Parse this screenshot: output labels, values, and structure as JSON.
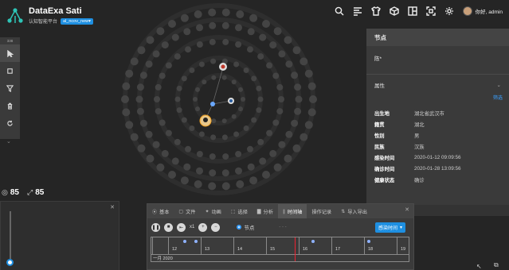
{
  "app": {
    "title": "DataExa Sati",
    "subtitle": "认知智能平台",
    "dataset_tag": "al_ncov_new▾"
  },
  "toolbar": {
    "icons": [
      "search-icon",
      "list-icon",
      "shirt-icon",
      "cube-icon",
      "layout-icon",
      "scan-icon",
      "gear-icon"
    ],
    "user_greeting": "你好, admin"
  },
  "left_tools": {
    "zoom_level": "338",
    "tools": [
      "pointer-icon",
      "rect-select-icon",
      "filter-icon",
      "delete-icon",
      "refresh-icon"
    ]
  },
  "counts": {
    "nodes": "85",
    "edges": "85"
  },
  "right_panel": {
    "header": "节点",
    "name": "陈*",
    "section_label": "属性",
    "filter_label": "筛选",
    "properties": [
      {
        "key": "出生地",
        "value": "湖北省武汉市"
      },
      {
        "key": "籍贯",
        "value": "湖北"
      },
      {
        "key": "性别",
        "value": "男"
      },
      {
        "key": "民族",
        "value": "汉族"
      },
      {
        "key": "感染时间",
        "value": "2020-01-12 09:09:56"
      },
      {
        "key": "确诊时间",
        "value": "2020-01-28 13:09:56"
      },
      {
        "key": "健康状态",
        "value": "确诊"
      }
    ]
  },
  "bottom_panel": {
    "tabs": [
      {
        "label": "基本",
        "icon": "circle-icon"
      },
      {
        "label": "文件",
        "icon": "folder-icon"
      },
      {
        "label": "动画",
        "icon": "wand-icon"
      },
      {
        "label": "选择",
        "icon": "select-icon"
      },
      {
        "label": "分析",
        "icon": "chart-icon"
      },
      {
        "label": "时间轴",
        "icon": "timeline-icon",
        "active": true
      },
      {
        "label": "操作记录",
        "icon": ""
      },
      {
        "label": "导入导出",
        "icon": "export-icon"
      }
    ],
    "speed": "x1",
    "node_option": "节点",
    "dashes": "- - -",
    "sort_field": "感染时间",
    "timeline": {
      "day_labels": [
        "12",
        "13",
        "14",
        "15",
        "16",
        "17",
        "18",
        "19"
      ],
      "month_label": "一月 2020"
    }
  },
  "colors": {
    "accent": "#1e8fe1",
    "cursor": "#e23333",
    "node": "#4a4a4a"
  }
}
